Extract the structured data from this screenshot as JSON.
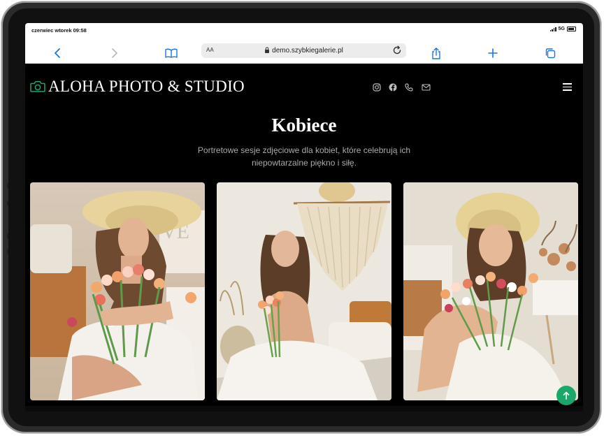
{
  "status_bar": {
    "time": "czerwiec wtorek 09:58",
    "network": "5G"
  },
  "browser": {
    "text_size_label": "AA",
    "url": "demo.szybkiegalerie.pl",
    "icons": [
      "back-icon",
      "forward-icon",
      "bookmarks-icon",
      "lock-icon",
      "reload-icon",
      "share-icon",
      "new-tab-icon",
      "tabs-icon"
    ]
  },
  "site": {
    "logo_text": "ALOHA PHOTO & STUDIO",
    "accent_color": "#1aa86a",
    "social_icons": [
      "instagram-icon",
      "facebook-icon",
      "phone-icon",
      "mail-icon"
    ]
  },
  "gallery": {
    "title": "Kobiece",
    "subtitle": "Portretowe sesje zdjęciowe dla kobiet, które celebrują ich niepowtarzalne piękno i siłę.",
    "photos": [
      {
        "name": "woman-hat-tulips"
      },
      {
        "name": "woman-sitting-macrame"
      },
      {
        "name": "woman-hat-smiling"
      }
    ]
  }
}
